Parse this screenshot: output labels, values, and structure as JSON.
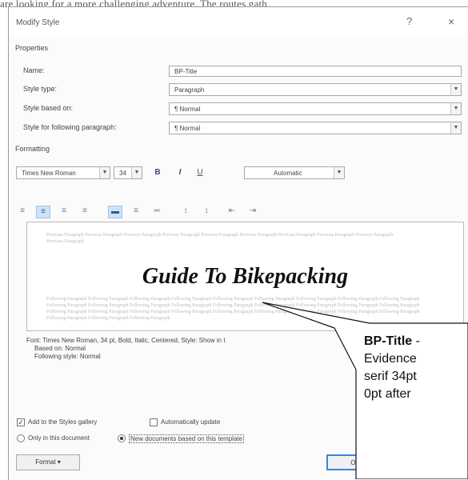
{
  "background": {
    "text": "are looking for a more challenging adventure. The routes gath"
  },
  "dialog": {
    "title": "Modify Style",
    "help": "?",
    "close": "×",
    "properties": {
      "heading": "Properties",
      "name_label": "Name:",
      "name_value": "BP-Title",
      "style_type_label": "Style type:",
      "style_type_value": "Paragraph",
      "based_on_label": "Style based on:",
      "based_on_value": "¶  Normal",
      "following_label": "Style for following paragraph:",
      "following_value": "¶  Normal"
    },
    "formatting": {
      "heading": "Formatting",
      "font": "Times New Roman",
      "size": "34",
      "bold": "B",
      "italic": "I",
      "underline": "U",
      "color": "Automatic"
    },
    "preview": {
      "previous_text": "Previous Paragraph Previous Paragraph Previous Paragraph Previous Paragraph Previous Paragraph Previous Paragraph Previous Paragraph Previous Paragraph Previous Paragraph Previous Paragraph",
      "sample_title": "Guide To Bikepacking",
      "following_text": "Following Paragraph Following Paragraph Following Paragraph Following Paragraph Following Paragraph Following Paragraph Following Paragraph Following Paragraph Following Paragraph Following Paragraph Following Paragraph Following Paragraph Following Paragraph Following Paragraph Following Paragraph Following Paragraph Following Paragraph Following Paragraph Following Paragraph Following Paragraph Following Paragraph Following Paragraph Following Paragraph Following Paragraph Following Paragraph Following Paragraph Following Paragraph Following Paragraph Following Paragraph Following Paragraph"
    },
    "description": {
      "line1": "Font: Times New Roman, 34 pt, Bold, Italic, Centered, Style: Show in t",
      "line2": "Based on: Normal",
      "line3": "Following style: Normal"
    },
    "options": {
      "add_gallery": "Add to the Styles gallery",
      "auto_update": "Automatically update",
      "only_doc": "Only in this document",
      "new_docs": "New documents based on this template"
    },
    "buttons": {
      "format": "Format ▾",
      "ok": "OK"
    }
  },
  "callout": {
    "title": "BP-Title",
    "rest1": " -",
    "line2": "Evidence",
    "line3": "serif 34pt",
    "line4": "0pt after"
  },
  "colors": {
    "accent": "#3b84d8",
    "selected": "#cde4f7"
  }
}
